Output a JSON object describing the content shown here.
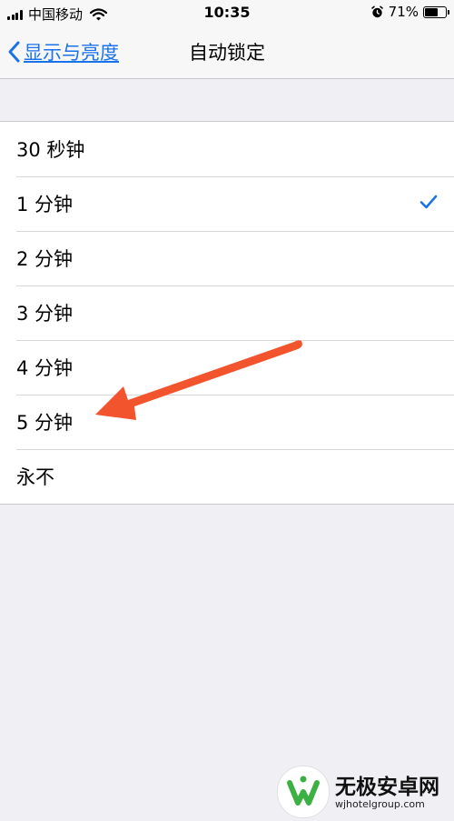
{
  "status_bar": {
    "carrier": "中国移动",
    "time": "10:35",
    "battery_percent": "71%",
    "battery_level": 0.71,
    "icons": [
      "signal-icon",
      "wifi-icon",
      "alarm-icon",
      "battery-icon"
    ]
  },
  "nav": {
    "back_label": "显示与亮度",
    "title": "自动锁定"
  },
  "options": [
    {
      "label": "30 秒钟",
      "selected": false
    },
    {
      "label": "1 分钟",
      "selected": true
    },
    {
      "label": "2 分钟",
      "selected": false
    },
    {
      "label": "3 分钟",
      "selected": false
    },
    {
      "label": "4 分钟",
      "selected": false
    },
    {
      "label": "5 分钟",
      "selected": false
    },
    {
      "label": "永不",
      "selected": false
    }
  ],
  "annotation": {
    "arrow_color": "#f2542d",
    "points_to": "5 分钟"
  },
  "watermark": {
    "title": "无极安卓网",
    "url": "wjhotelgroup.com"
  },
  "colors": {
    "accent": "#1a73e8",
    "background": "#efeff4",
    "checkmark": "#1a73e8",
    "arrow": "#f2542d",
    "logo_green": "#3cb043"
  }
}
